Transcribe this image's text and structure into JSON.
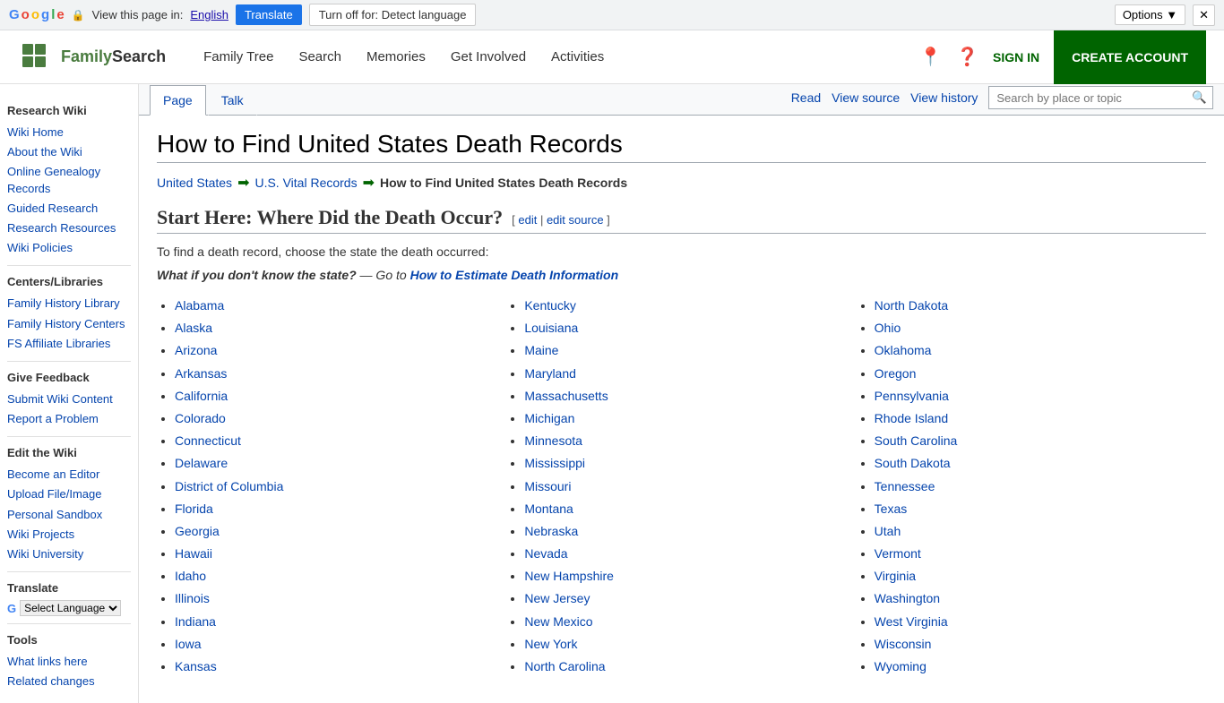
{
  "translate_bar": {
    "view_text": "View this page in:",
    "language": "English",
    "translate_btn": "Translate",
    "turn_off_btn": "Turn off for: Detect language",
    "options_btn": "Options ▼",
    "close_btn": "✕"
  },
  "nav": {
    "logo_text_family": "Family",
    "logo_text_search": "Search",
    "links": [
      "Family Tree",
      "Search",
      "Memories",
      "Get Involved",
      "Activities"
    ],
    "sign_in": "SIGN IN",
    "create_account": "CREATE ACCOUNT"
  },
  "sidebar": {
    "research_wiki_title": "Research Wiki",
    "research_items": [
      "Wiki Home",
      "About the Wiki",
      "Online Genealogy Records",
      "Guided Research",
      "Research Resources",
      "Wiki Policies"
    ],
    "centers_title": "Centers/Libraries",
    "centers_items": [
      "Family History Library",
      "Family History Centers",
      "FS Affiliate Libraries"
    ],
    "feedback_title": "Give Feedback",
    "feedback_items": [
      "Submit Wiki Content",
      "Report a Problem"
    ],
    "edit_title": "Edit the Wiki",
    "edit_items": [
      "Become an Editor",
      "Upload File/Image",
      "Personal Sandbox",
      "Wiki Projects",
      "Wiki University"
    ],
    "translate_title": "Translate",
    "select_language": "Select Language",
    "tools_title": "Tools",
    "tools_items": [
      "What links here",
      "Related changes"
    ]
  },
  "tabs": {
    "page": "Page",
    "talk": "Talk",
    "read": "Read",
    "view_source": "View source",
    "view_history": "View history",
    "search_placeholder": "Search by place or topic"
  },
  "article": {
    "title": "How to Find United States Death Records",
    "breadcrumb": {
      "part1": "United States",
      "part2": "U.S. Vital Records",
      "part3": "How to Find United States Death Records"
    },
    "section_heading": "Start Here: Where Did the Death Occur?",
    "edit_label": "[ edit | edit source ]",
    "intro": "To find a death record, choose the state the death occurred:",
    "italic_note_plain": "What if you don't know the state?",
    "italic_note_middle": " — Go to ",
    "italic_note_link": "How to Estimate Death Information",
    "columns": {
      "col1": [
        "Alabama",
        "Alaska",
        "Arizona",
        "Arkansas",
        "California",
        "Colorado",
        "Connecticut",
        "Delaware",
        "District of Columbia",
        "Florida",
        "Georgia",
        "Hawaii",
        "Idaho",
        "Illinois",
        "Indiana",
        "Iowa",
        "Kansas"
      ],
      "col2": [
        "Kentucky",
        "Louisiana",
        "Maine",
        "Maryland",
        "Massachusetts",
        "Michigan",
        "Minnesota",
        "Mississippi",
        "Missouri",
        "Montana",
        "Nebraska",
        "Nevada",
        "New Hampshire",
        "New Jersey",
        "New Mexico",
        "New York",
        "North Carolina"
      ],
      "col3": [
        "North Dakota",
        "Ohio",
        "Oklahoma",
        "Oregon",
        "Pennsylvania",
        "Rhode Island",
        "South Carolina",
        "South Dakota",
        "Tennessee",
        "Texas",
        "Utah",
        "Vermont",
        "Virginia",
        "Washington",
        "West Virginia",
        "Wisconsin",
        "Wyoming"
      ]
    }
  }
}
